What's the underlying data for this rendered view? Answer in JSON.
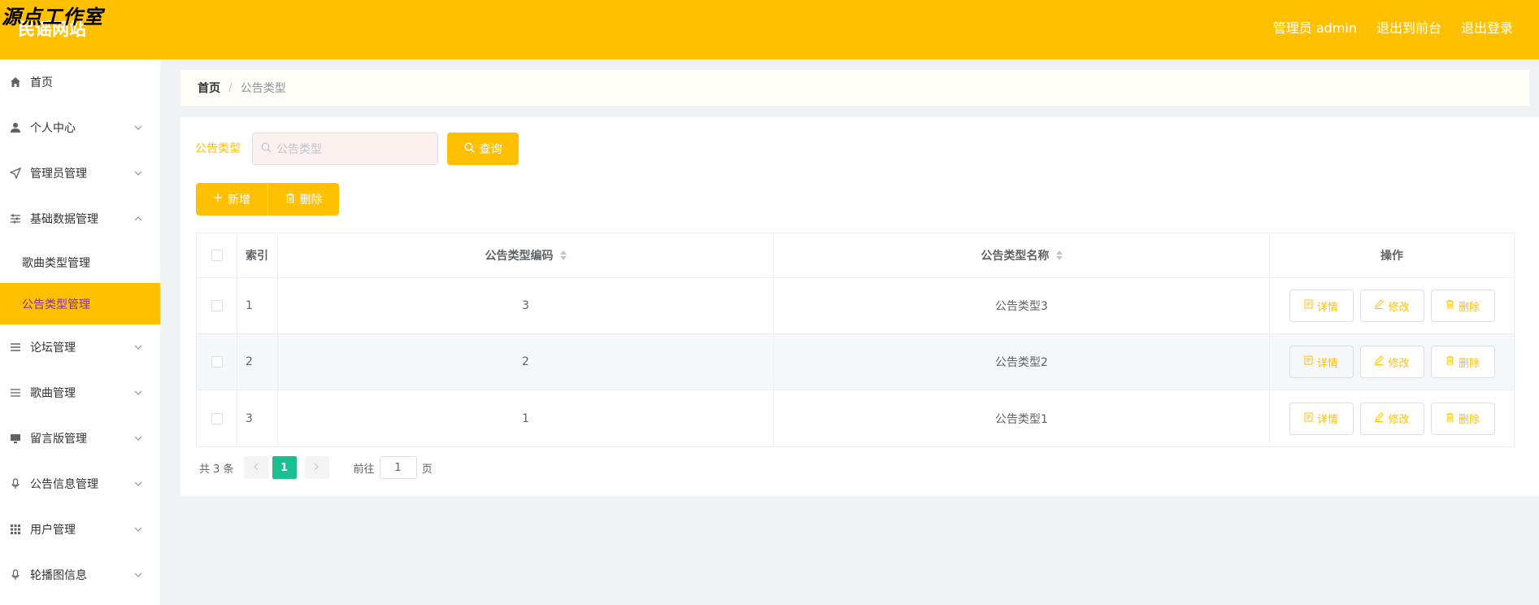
{
  "header": {
    "watermark": "源点工作室",
    "site_title": "民谣网站",
    "admin_label": "管理员 admin",
    "to_front": "退出到前台",
    "logout": "退出登录"
  },
  "sidebar": {
    "items": [
      {
        "label": "首页",
        "icon": "home-icon"
      },
      {
        "label": "个人中心",
        "icon": "user-icon"
      },
      {
        "label": "管理员管理",
        "icon": "send-icon"
      },
      {
        "label": "基础数据管理",
        "icon": "sliders-icon"
      },
      {
        "label": "论坛管理",
        "icon": "list-icon"
      },
      {
        "label": "歌曲管理",
        "icon": "list-icon"
      },
      {
        "label": "留言版管理",
        "icon": "monitor-icon"
      },
      {
        "label": "公告信息管理",
        "icon": "microphone-icon"
      },
      {
        "label": "用户管理",
        "icon": "grid-icon"
      },
      {
        "label": "轮播图信息",
        "icon": "microphone-icon"
      }
    ],
    "sub_items": [
      "歌曲类型管理",
      "公告类型管理"
    ]
  },
  "breadcrumb": {
    "home": "首页",
    "sep": "/",
    "current": "公告类型"
  },
  "search": {
    "label": "公告类型",
    "placeholder": "公告类型",
    "button": "查询"
  },
  "actions": {
    "add": "新增",
    "delete": "删除"
  },
  "table": {
    "columns": {
      "index": "索引",
      "code": "公告类型编码",
      "name": "公告类型名称",
      "op": "操作"
    },
    "rows": [
      {
        "index": "1",
        "code": "3",
        "name": "公告类型3"
      },
      {
        "index": "2",
        "code": "2",
        "name": "公告类型2"
      },
      {
        "index": "3",
        "code": "1",
        "name": "公告类型1"
      }
    ],
    "op_labels": {
      "detail": "详情",
      "edit": "修改",
      "delete": "删除"
    }
  },
  "pagination": {
    "total": "共 3 条",
    "current": "1",
    "goto": "前往",
    "goto_value": "1",
    "page_unit": "页"
  },
  "colors": {
    "accent": "#ffc000",
    "active_sub_text": "#8b2cbd",
    "page_active": "#19be91"
  }
}
